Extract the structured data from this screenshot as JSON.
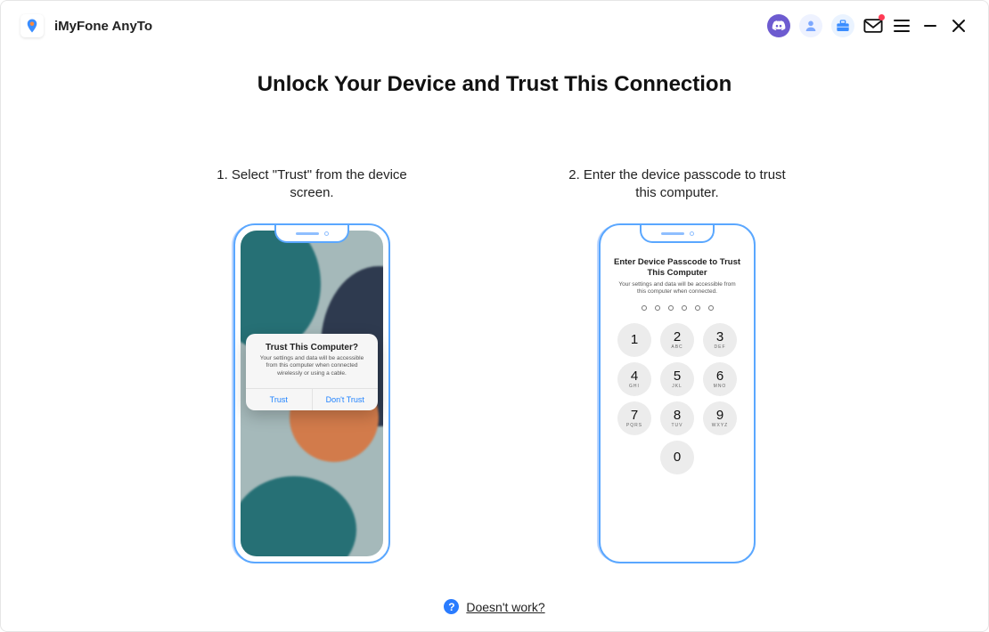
{
  "app": {
    "title": "iMyFone AnyTo"
  },
  "icons": {
    "discord": "discord-icon",
    "user": "user-icon",
    "tools": "toolbox-icon",
    "mail": "mail-icon",
    "menu": "menu-icon",
    "minimize": "minimize-icon",
    "close": "close-icon",
    "logo": "location-pin-icon",
    "help": "help-icon"
  },
  "page": {
    "title": "Unlock Your Device and Trust This Connection"
  },
  "steps": {
    "one": {
      "label": "1. Select \"Trust\" from the device screen."
    },
    "two": {
      "label": "2. Enter the device passcode to trust this computer."
    }
  },
  "alert": {
    "title": "Trust This Computer?",
    "message": "Your settings and data will be accessible from this computer when connected wirelessly or using a cable.",
    "trust": "Trust",
    "dont_trust": "Don't Trust"
  },
  "passcode": {
    "title": "Enter Device Passcode to Trust This Computer",
    "message": "Your settings and data will be accessible from this computer when connected.",
    "digits": 6,
    "keys": [
      {
        "n": "1",
        "l": ""
      },
      {
        "n": "2",
        "l": "ABC"
      },
      {
        "n": "3",
        "l": "DEF"
      },
      {
        "n": "4",
        "l": "GHI"
      },
      {
        "n": "5",
        "l": "JKL"
      },
      {
        "n": "6",
        "l": "MNO"
      },
      {
        "n": "7",
        "l": "PQRS"
      },
      {
        "n": "8",
        "l": "TUV"
      },
      {
        "n": "9",
        "l": "WXYZ"
      },
      {
        "n": "0",
        "l": ""
      }
    ]
  },
  "help": {
    "label": "Doesn't work?"
  }
}
